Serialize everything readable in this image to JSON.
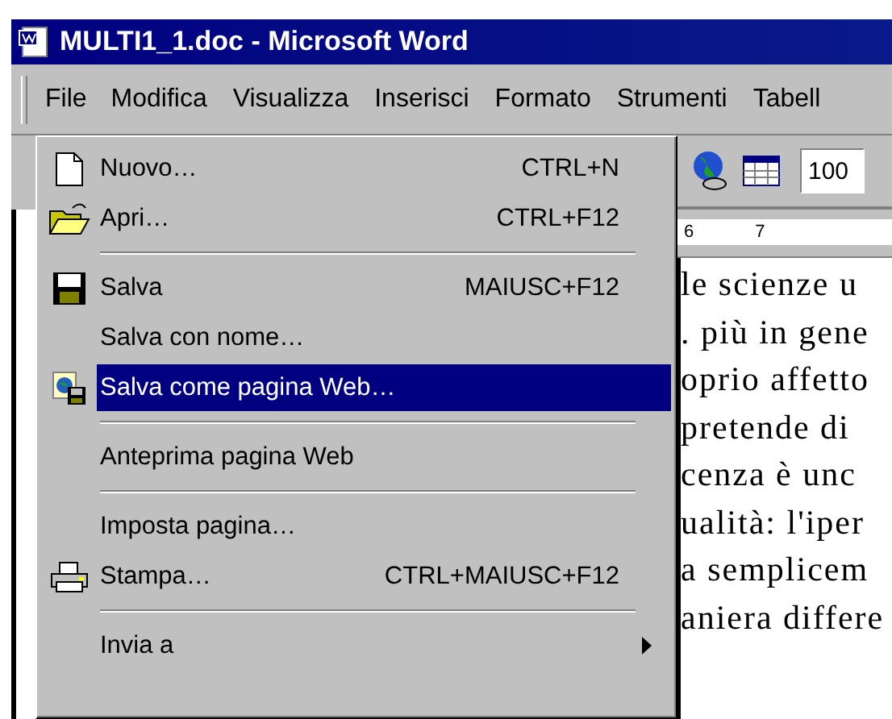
{
  "window": {
    "title": "MULTI1_1.doc - Microsoft Word"
  },
  "menu_bar": [
    {
      "label": "File",
      "selected": true
    },
    {
      "label": "Modifica",
      "selected": false
    },
    {
      "label": "Visualizza",
      "selected": false
    },
    {
      "label": "Inserisci",
      "selected": false
    },
    {
      "label": "Formato",
      "selected": false
    },
    {
      "label": "Strumenti",
      "selected": false
    },
    {
      "label": "Tabell",
      "selected": false
    }
  ],
  "file_menu": [
    {
      "kind": "item",
      "label": "Nuovo…",
      "shortcut": "CTRL+N",
      "selected": false
    },
    {
      "kind": "item",
      "label": "Apri…",
      "shortcut": "CTRL+F12",
      "selected": false
    },
    {
      "kind": "separator"
    },
    {
      "kind": "item",
      "label": "Salva",
      "shortcut": "MAIUSC+F12",
      "selected": false
    },
    {
      "kind": "item",
      "label": "Salva con nome…",
      "selected": false
    },
    {
      "kind": "item",
      "label": "Salva come pagina Web…",
      "selected": true
    },
    {
      "kind": "separator"
    },
    {
      "kind": "item",
      "label": "Anteprima pagina Web",
      "selected": false
    },
    {
      "kind": "separator"
    },
    {
      "kind": "item",
      "label": "Imposta pagina…",
      "selected": false
    },
    {
      "kind": "item",
      "label": "Stampa…",
      "shortcut": "CTRL+MAIUSC+F12",
      "selected": false
    },
    {
      "kind": "separator"
    },
    {
      "kind": "submenu",
      "label": "Invia a",
      "selected": false
    }
  ],
  "toolbar": {
    "zoom": "100"
  },
  "ruler": [
    "6",
    "7"
  ],
  "document": {
    "lines": [
      "le scienze u",
      ". più in gene",
      "oprio affetto",
      "pretende di",
      "cenza è unc",
      "ualità:  l'iper",
      "a semplicem",
      "aniera differe"
    ]
  }
}
